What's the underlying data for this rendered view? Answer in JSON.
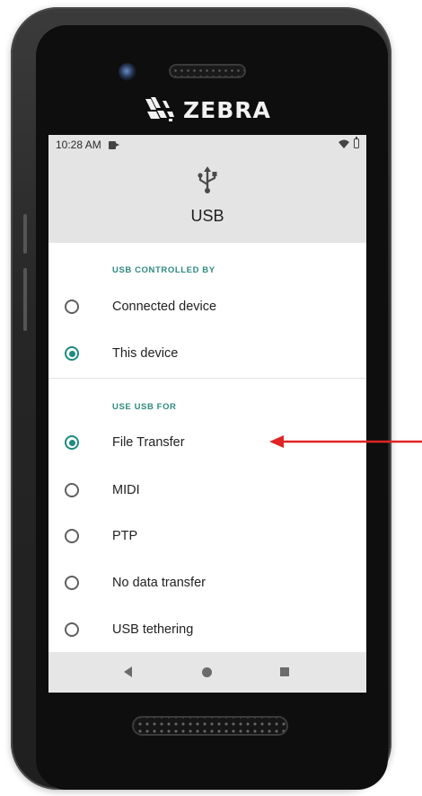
{
  "device": {
    "brand": "ZEBRA"
  },
  "status_bar": {
    "time": "10:28 AM"
  },
  "header": {
    "icon": "usb-icon",
    "title": "USB"
  },
  "sections": [
    {
      "label": "USB CONTROLLED BY",
      "options": [
        {
          "label": "Connected device",
          "selected": false
        },
        {
          "label": "This device",
          "selected": true
        }
      ]
    },
    {
      "label": "USE USB FOR",
      "options": [
        {
          "label": "File Transfer",
          "selected": true
        },
        {
          "label": "MIDI",
          "selected": false
        },
        {
          "label": "PTP",
          "selected": false
        },
        {
          "label": "No data transfer",
          "selected": false
        },
        {
          "label": "USB tethering",
          "selected": false
        }
      ]
    }
  ],
  "nav_bar": {
    "buttons": [
      "back-icon",
      "home-icon",
      "recents-icon"
    ]
  },
  "colors": {
    "accent": "#1f8a82",
    "section_label": "#2e8a80",
    "annotation_arrow": "#e02424",
    "header_bg": "#e4e4e4"
  }
}
